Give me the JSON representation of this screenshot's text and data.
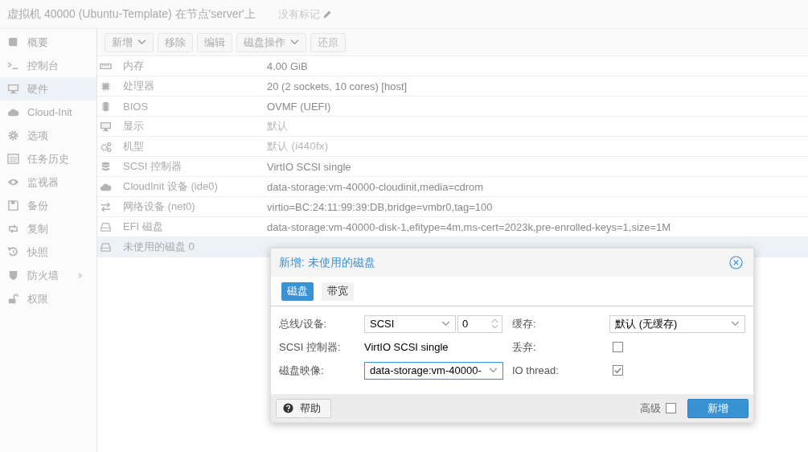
{
  "header": {
    "title": "虚拟机 40000 (Ubuntu-Template) 在节点'server'上",
    "tags": "没有标记"
  },
  "sidebar": {
    "items": [
      {
        "label": "概要",
        "selected": false,
        "expandable": false
      },
      {
        "label": "控制台",
        "selected": false,
        "expandable": false
      },
      {
        "label": "硬件",
        "selected": true,
        "expandable": false
      },
      {
        "label": "Cloud-Init",
        "selected": false,
        "expandable": false
      },
      {
        "label": "选项",
        "selected": false,
        "expandable": false
      },
      {
        "label": "任务历史",
        "selected": false,
        "expandable": false
      },
      {
        "label": "监视器",
        "selected": false,
        "expandable": false
      },
      {
        "label": "备份",
        "selected": false,
        "expandable": false
      },
      {
        "label": "复制",
        "selected": false,
        "expandable": false
      },
      {
        "label": "快照",
        "selected": false,
        "expandable": false
      },
      {
        "label": "防火墙",
        "selected": false,
        "expandable": true
      },
      {
        "label": "权限",
        "selected": false,
        "expandable": false
      }
    ]
  },
  "toolbar": [
    {
      "label": "新增",
      "dropdown": true,
      "disabled": false
    },
    {
      "label": "移除",
      "dropdown": false,
      "disabled": false
    },
    {
      "label": "编辑",
      "dropdown": false,
      "disabled": false
    },
    {
      "label": "磁盘操作",
      "dropdown": true,
      "disabled": false
    },
    {
      "label": "还原",
      "dropdown": false,
      "disabled": true
    }
  ],
  "hardware": [
    {
      "name": "内存",
      "value": "4.00 GiB",
      "default": false,
      "selected": false
    },
    {
      "name": "处理器",
      "value": "20 (2 sockets, 10 cores) [host]",
      "default": false,
      "selected": false
    },
    {
      "name": "BIOS",
      "value": "OVMF (UEFI)",
      "default": false,
      "selected": false
    },
    {
      "name": "显示",
      "value": "默认",
      "default": true,
      "selected": false
    },
    {
      "name": "机型",
      "value": "默认 (i440fx)",
      "default": true,
      "selected": false
    },
    {
      "name": "SCSI 控制器",
      "value": "VirtIO SCSI single",
      "default": false,
      "selected": false
    },
    {
      "name": "CloudInit 设备 (ide0)",
      "value": "data-storage:vm-40000-cloudinit,media=cdrom",
      "default": false,
      "selected": false
    },
    {
      "name": "网络设备 (net0)",
      "value": "virtio=BC:24:11:99:39:DB,bridge=vmbr0,tag=100",
      "default": false,
      "selected": false
    },
    {
      "name": "EFI 磁盘",
      "value": "data-storage:vm-40000-disk-1,efitype=4m,ms-cert=2023k,pre-enrolled-keys=1,size=1M",
      "default": false,
      "selected": false
    },
    {
      "name": "未使用的磁盘 0",
      "selected": true
    }
  ],
  "dialog": {
    "title": "新增: 未使用的磁盘",
    "tabs": [
      {
        "label": "磁盘",
        "selected": true
      },
      {
        "label": "带宽",
        "selected": false
      }
    ],
    "left": [
      {
        "kind": "bus",
        "label": "总线/设备:",
        "value": "SCSI",
        "number": "0",
        "focused": false
      },
      {
        "kind": "text",
        "label": "SCSI 控制器:",
        "value": "VirtIO SCSI single"
      },
      {
        "kind": "select",
        "label": "磁盘映像:",
        "value": "data-storage:vm-40000-",
        "focused": true
      }
    ],
    "right": [
      {
        "kind": "select",
        "label": "缓存:",
        "value": "默认 (无缓存)",
        "focused": false
      },
      {
        "kind": "checkbox",
        "label": "丢弃:",
        "checked": false
      },
      {
        "kind": "checkbox",
        "label": "IO thread:",
        "checked": true
      }
    ],
    "help": "帮助",
    "advanced": {
      "label": "高级",
      "checked": false
    },
    "submit": "新增"
  }
}
